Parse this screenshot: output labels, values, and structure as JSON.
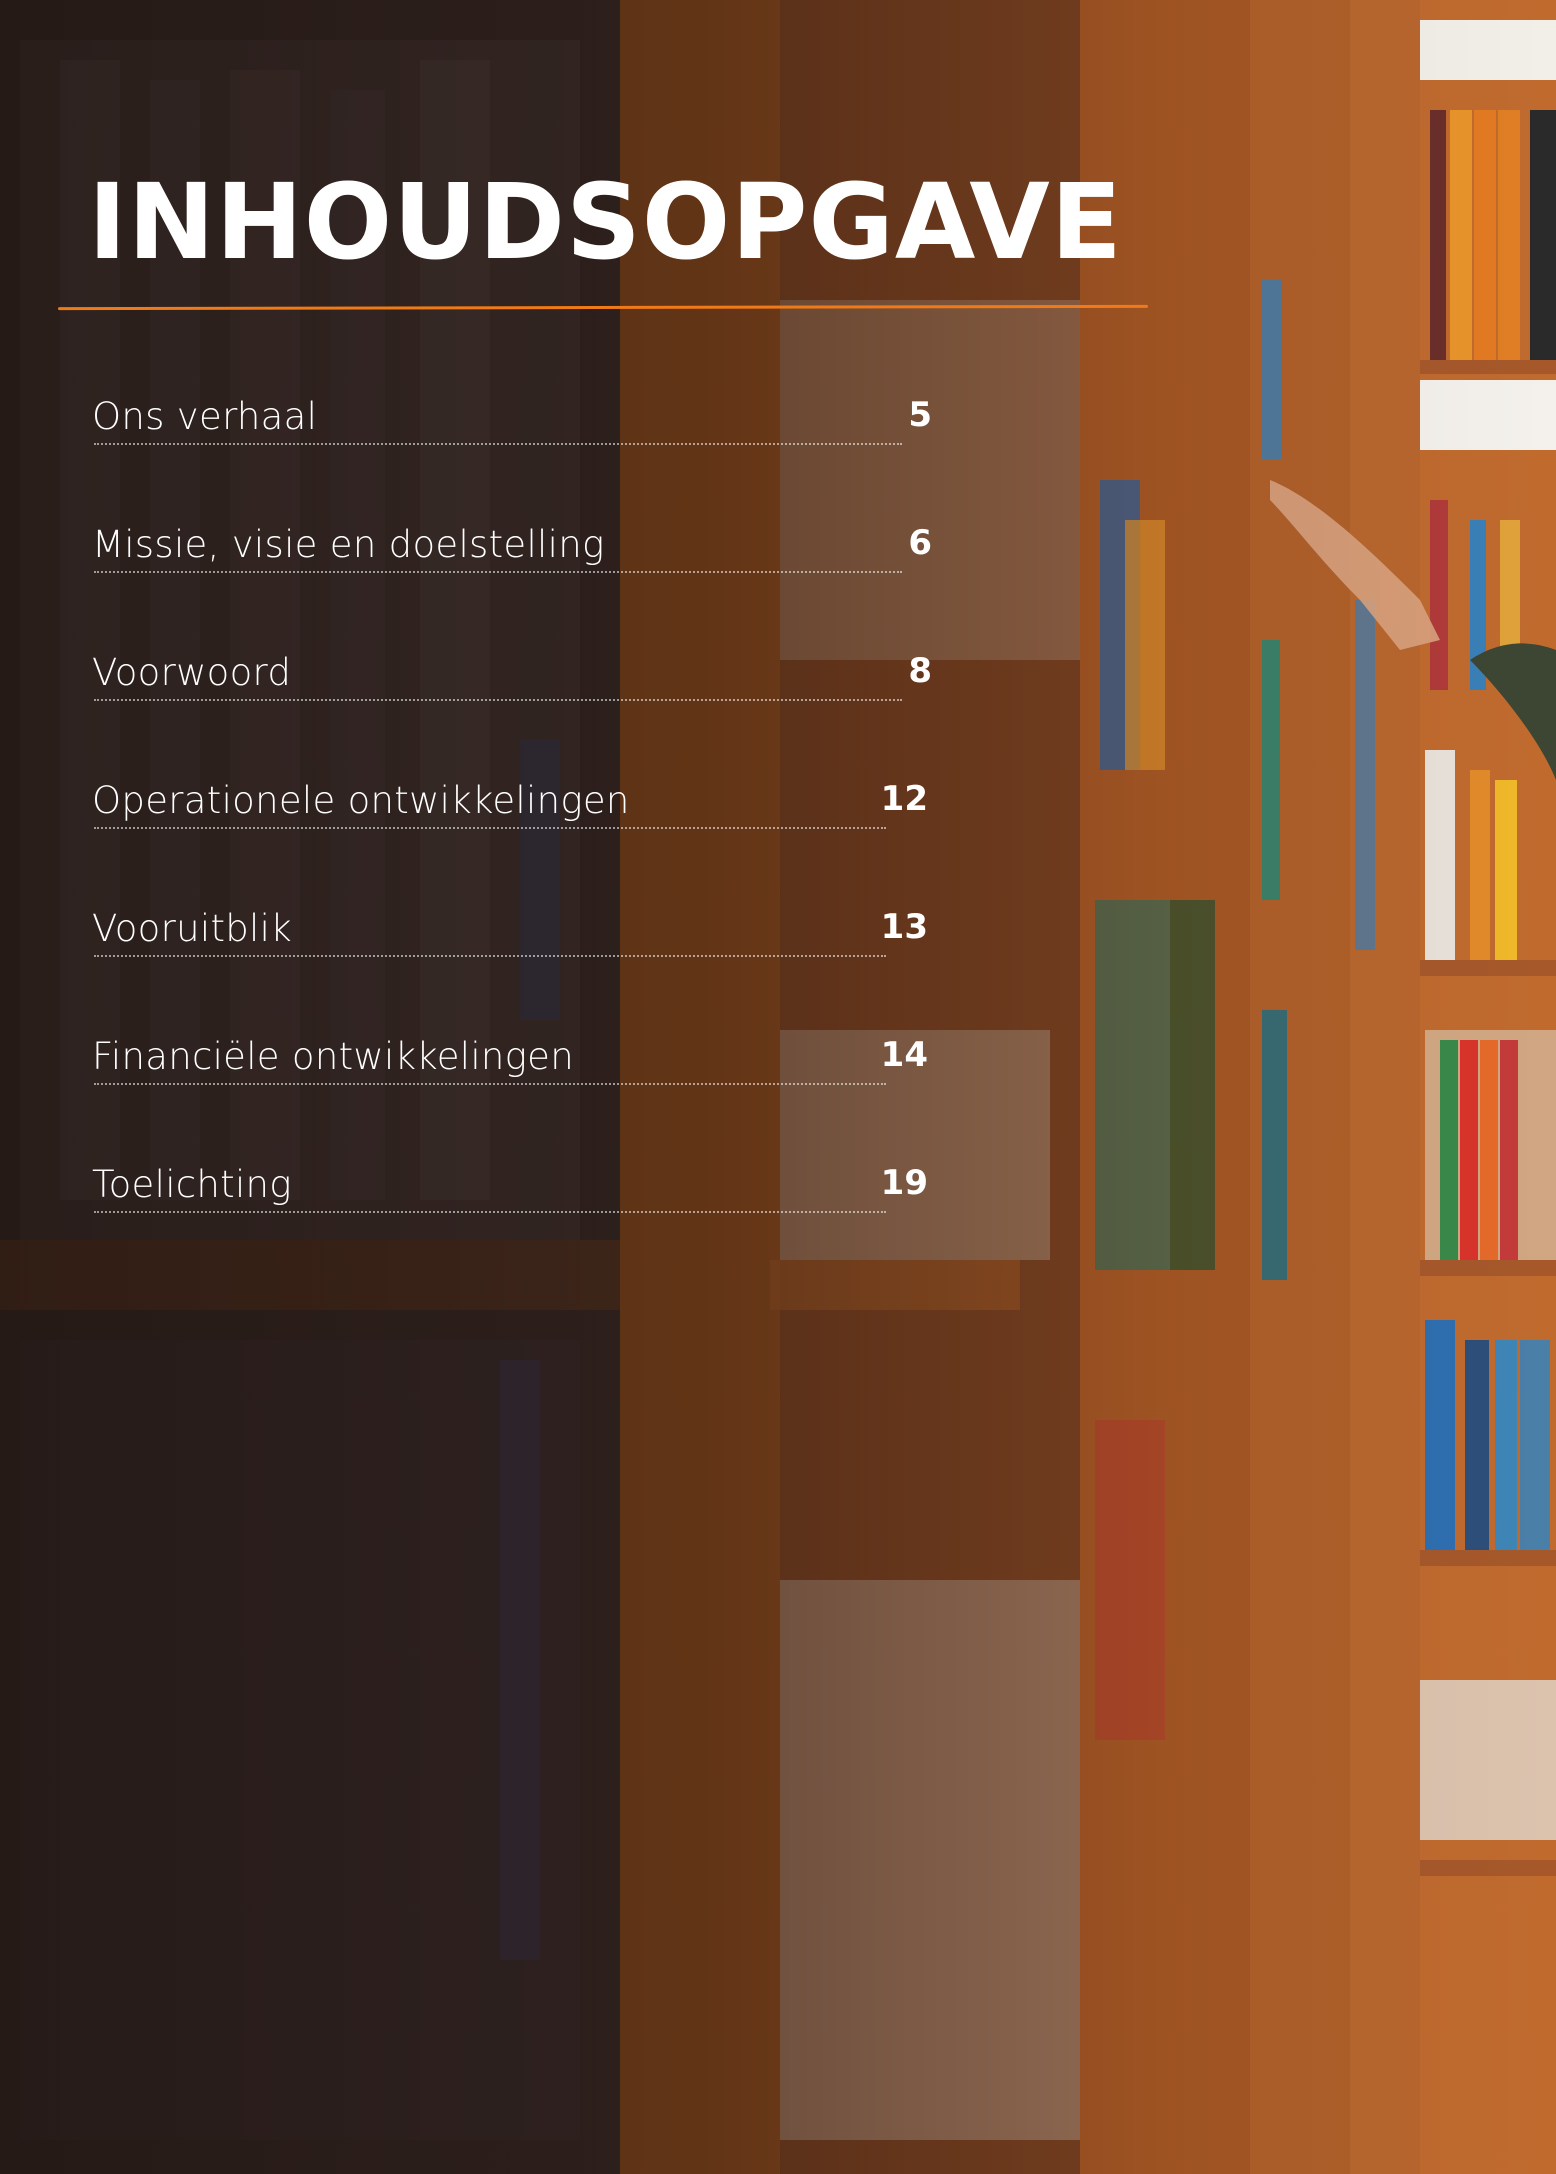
{
  "document": {
    "title": "INHOUDSOPGAVE",
    "accent_color": "#f07a18",
    "text_color": "#ffffff",
    "background_image": "library-bookshelves-photo",
    "toc": [
      {
        "label": "Ons verhaal",
        "page": "5"
      },
      {
        "label": "Missie, visie en doelstelling",
        "page": "6"
      },
      {
        "label": "Voorwoord",
        "page": "8"
      },
      {
        "label": "Operationele ontwikkelingen",
        "page": "12"
      },
      {
        "label": "Vooruitblik",
        "page": "13"
      },
      {
        "label": "Financiële ontwikkelingen",
        "page": "14"
      },
      {
        "label": "Toelichting",
        "page": "19"
      }
    ]
  }
}
